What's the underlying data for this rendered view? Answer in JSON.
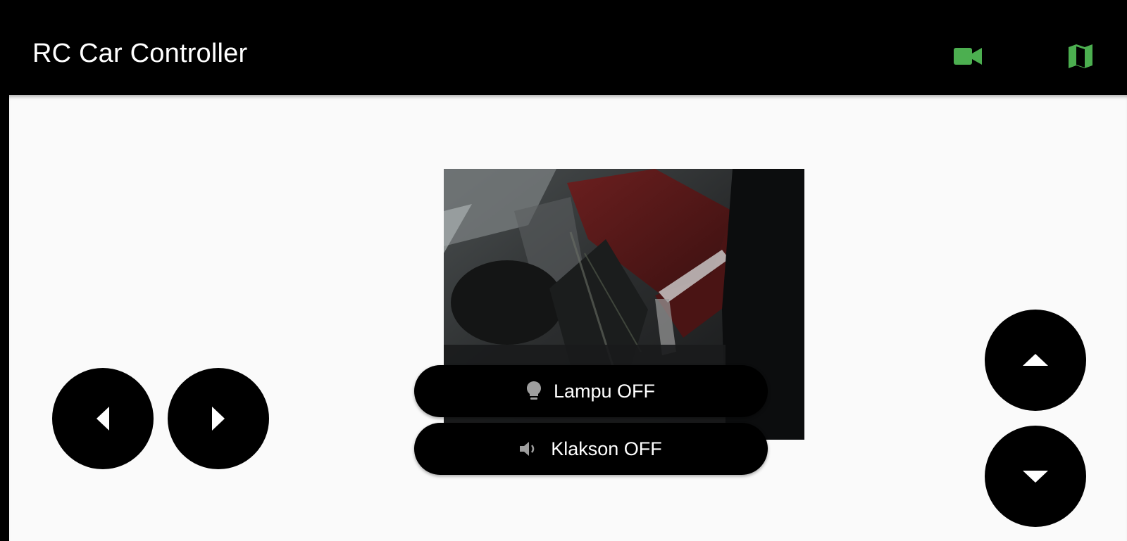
{
  "appbar": {
    "title": "RC Car Controller",
    "actions": [
      {
        "icon": "videocam-icon",
        "color": "#4caf50"
      },
      {
        "icon": "map-icon",
        "color": "#4caf50"
      }
    ]
  },
  "camera": {
    "description_icon": "camera-feed"
  },
  "controls": {
    "steer_left_icon": "arrow-left-icon",
    "steer_right_icon": "arrow-right-icon",
    "forward_icon": "arrow-up-icon",
    "reverse_icon": "arrow-down-icon"
  },
  "toggles": {
    "lamp_label": "Lampu OFF",
    "lamp_icon": "lightbulb-icon",
    "horn_label": "Klakson OFF",
    "horn_icon": "volume-icon"
  },
  "theme": {
    "accent": "#4caf50",
    "button_bg": "#000000",
    "surface": "#fafafa"
  }
}
